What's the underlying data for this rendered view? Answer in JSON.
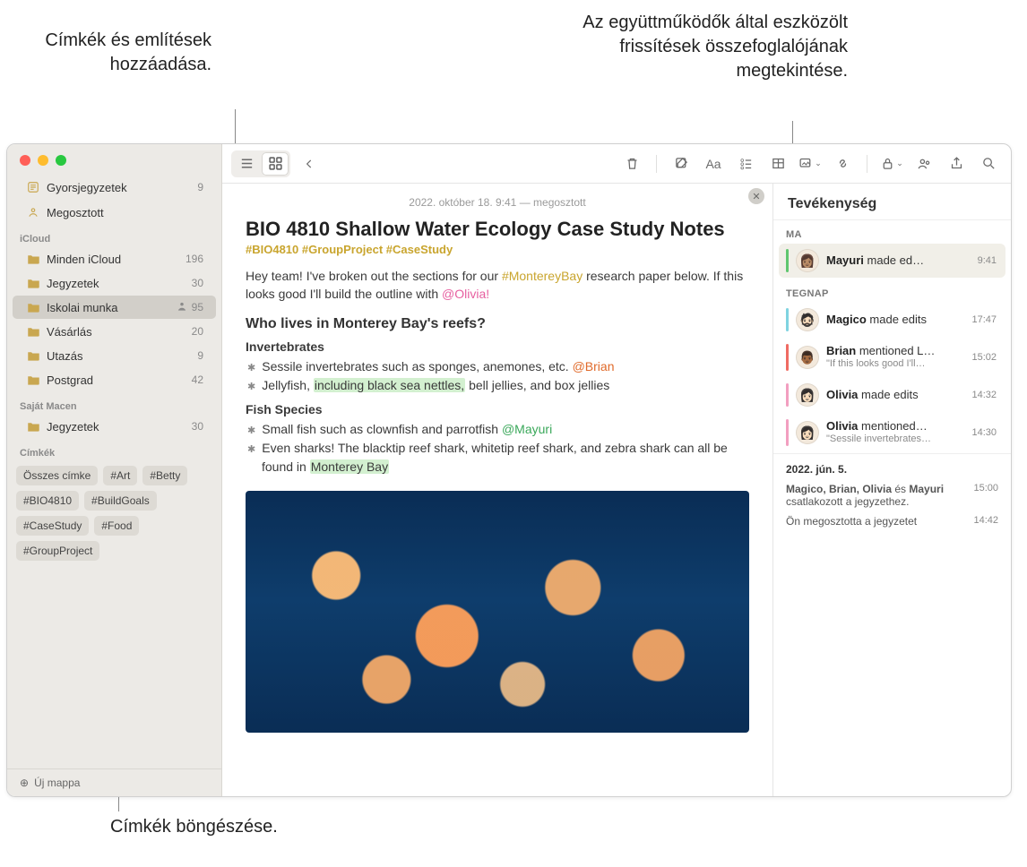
{
  "callouts": {
    "tags_mentions": "Címkék és említések hozzáadása.",
    "activity_summary": "Az együttműködők által eszközölt frissítések összefoglalójának megtekintése.",
    "browse_tags": "Címkék böngészése."
  },
  "sidebar": {
    "quick": {
      "label": "Gyorsjegyzetek",
      "count": "9"
    },
    "shared": {
      "label": "Megosztott"
    },
    "sections": {
      "icloud": "iCloud",
      "local": "Saját Macen",
      "tags": "Címkék"
    },
    "icloud_items": [
      {
        "label": "Minden iCloud",
        "count": "196"
      },
      {
        "label": "Jegyzetek",
        "count": "30"
      },
      {
        "label": "Iskolai munka",
        "count": "95",
        "shared": true,
        "selected": true
      },
      {
        "label": "Vásárlás",
        "count": "20"
      },
      {
        "label": "Utazás",
        "count": "9"
      },
      {
        "label": "Postgrad",
        "count": "42"
      }
    ],
    "local_items": [
      {
        "label": "Jegyzetek",
        "count": "30"
      }
    ],
    "tags": [
      "Összes címke",
      "#Art",
      "#Betty",
      "#BIO4810",
      "#BuildGoals",
      "#CaseStudy",
      "#Food",
      "#GroupProject"
    ],
    "new_folder": "Új mappa"
  },
  "note": {
    "date": "2022. október 18. 9:41 — megosztott",
    "title": "BIO 4810 Shallow Water Ecology Case Study Notes",
    "tags": "#BIO4810 #GroupProject #CaseStudy",
    "intro_a": "Hey team! I've broken out the sections for our ",
    "intro_hash": "#MontereyBay",
    "intro_b": " research paper below. If this looks good I'll build the outline with ",
    "intro_mention": "@Olivia!",
    "h2": "Who lives in Monterey Bay's reefs?",
    "invert_h": "Invertebrates",
    "invert_1a": "Sessile invertebrates such as sponges, anemones, etc. ",
    "invert_1m": "@Brian",
    "invert_2a": "Jellyfish, ",
    "invert_2hl": "including black sea nettles,",
    "invert_2b": " bell jellies, and box jellies",
    "fish_h": "Fish Species",
    "fish_1a": "Small fish such as clownfish and parrotfish ",
    "fish_1m": "@Mayuri",
    "fish_2a": "Even sharks! The blacktip reef shark, whitetip reef shark, and zebra shark can all be found in ",
    "fish_2hl": "Monterey Bay"
  },
  "activity": {
    "title": "Tevékenység",
    "today": "MA",
    "yesterday": "TEGNAP",
    "items_today": [
      {
        "who": "Mayuri",
        "action": " made ed…",
        "time": "9:41",
        "bar": "bar-green",
        "emoji": "👩🏽"
      }
    ],
    "items_yesterday": [
      {
        "who": "Magico",
        "action": " made edits",
        "time": "17:47",
        "bar": "bar-teal",
        "emoji": "🧔🏻"
      },
      {
        "who": "Brian",
        "action": " mentioned L…",
        "sub": "\"If this looks good I'll…",
        "time": "15:02",
        "bar": "bar-red",
        "emoji": "👨🏾"
      },
      {
        "who": "Olivia",
        "action": " made edits",
        "time": "14:32",
        "bar": "bar-pink",
        "emoji": "👩🏻"
      },
      {
        "who": "Olivia",
        "action": " mentioned…",
        "sub": "\"Sessile invertebrates…",
        "time": "14:30",
        "bar": "bar-pink",
        "emoji": "👩🏻"
      }
    ],
    "footer_date": "2022. jún. 5.",
    "footer_join_names": "Magico, Brian, Olivia",
    "footer_join_and": " és ",
    "footer_join_last": "Mayuri",
    "footer_join_text": " csatlakozott a jegyzethez.",
    "footer_join_time": "15:00",
    "footer_share": "Ön megosztotta a jegyzetet",
    "footer_share_time": "14:42"
  }
}
